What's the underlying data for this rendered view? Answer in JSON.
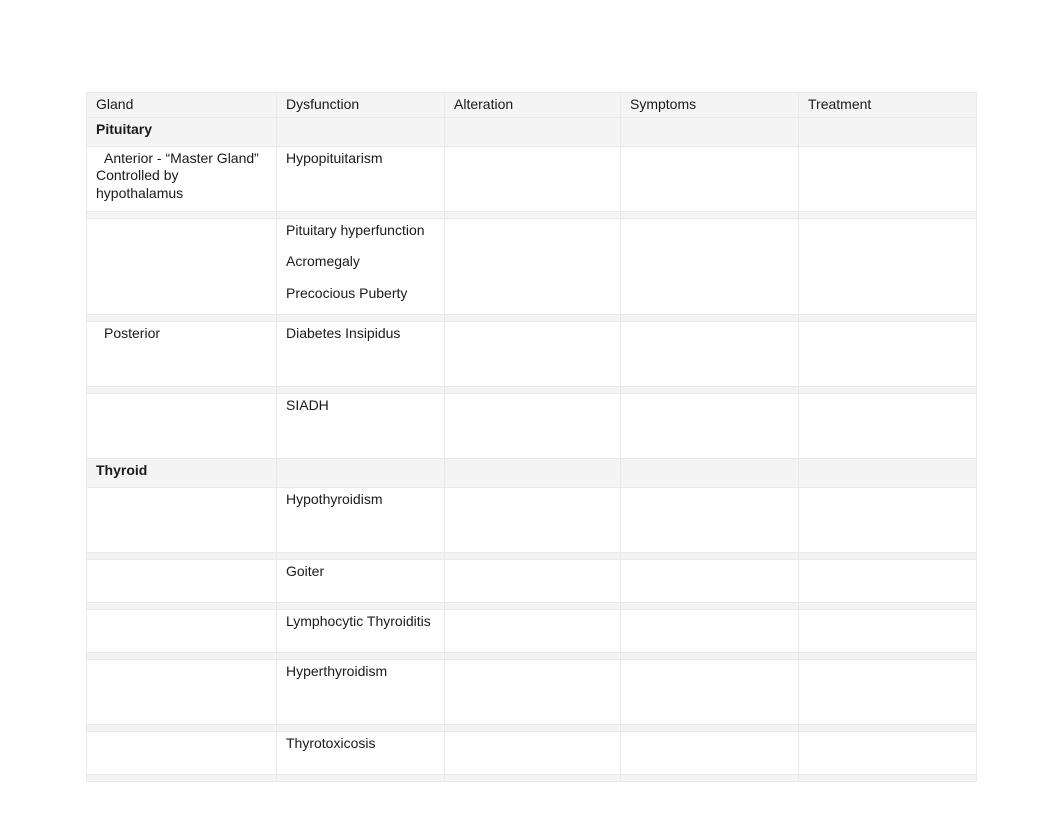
{
  "headers": {
    "gland": "Gland",
    "dysfunction": "Dysfunction",
    "alteration": "Alteration",
    "symptoms": "Symptoms",
    "treatment": "Treatment"
  },
  "groups": {
    "pituitary": "Pituitary",
    "thyroid": "Thyroid"
  },
  "rows": {
    "anterior": {
      "gland_line1": "Anterior - “Master Gland”",
      "gland_line2": "Controlled by hypothalamus",
      "dys": "Hypopituitarism"
    },
    "pit_hyper": {
      "dys_l1": "Pituitary hyperfunction",
      "dys_l2": "Acromegaly",
      "dys_l3": "Precocious Puberty"
    },
    "posterior": {
      "gland": "Posterior",
      "dys": "Diabetes Insipidus"
    },
    "siadh": {
      "dys": "SIADH"
    },
    "hypothyroid": {
      "dys": "Hypothyroidism"
    },
    "goiter": {
      "dys": "Goiter"
    },
    "lympho": {
      "dys": "Lymphocytic Thyroiditis"
    },
    "hyperthyroid": {
      "dys": "Hyperthyroidism"
    },
    "thyrotox": {
      "dys": "Thyrotoxicosis"
    }
  }
}
